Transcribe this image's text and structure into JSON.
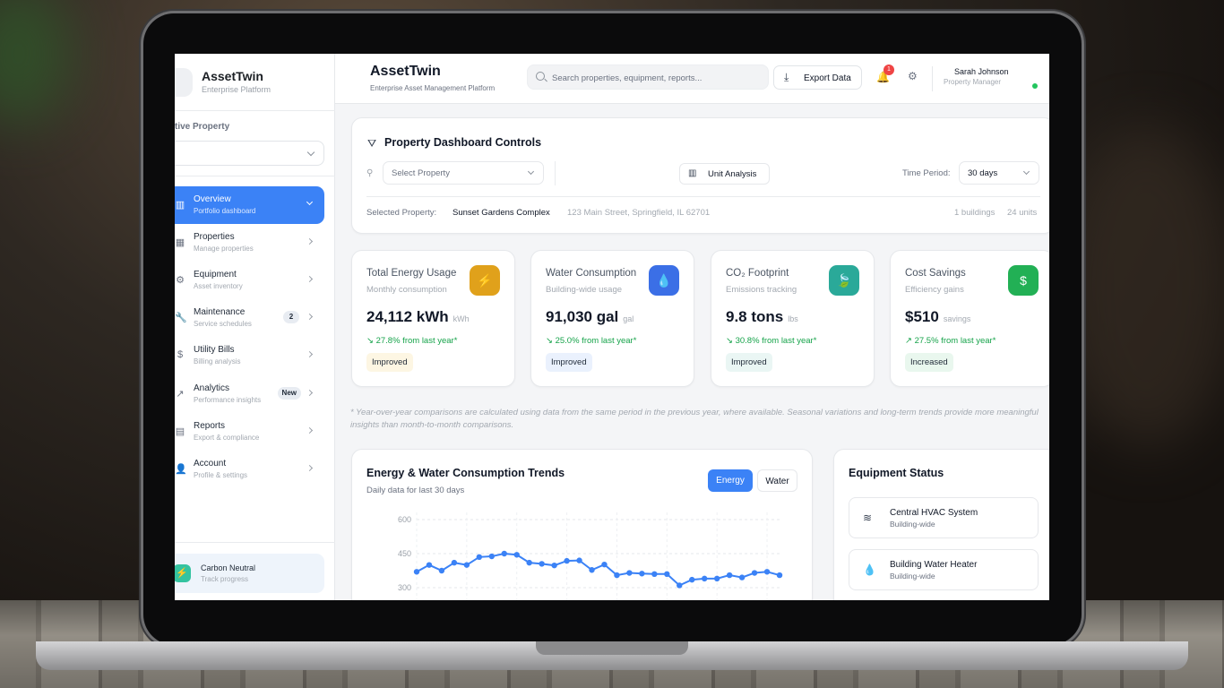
{
  "sidebar": {
    "brand": "AssetTwin",
    "brand_sub": "Enterprise Platform",
    "active_property_label": "tive Property",
    "items": [
      {
        "title": "Overview",
        "sub": "Portfolio dashboard",
        "icon": "bar-chart-icon"
      },
      {
        "title": "Properties",
        "sub": "Manage properties",
        "icon": "building-icon"
      },
      {
        "title": "Equipment",
        "sub": "Asset inventory",
        "icon": "gear-icon"
      },
      {
        "title": "Maintenance",
        "sub": "Service schedules",
        "icon": "wrench-icon",
        "badge": "2"
      },
      {
        "title": "Utility Bills",
        "sub": "Billing analysis",
        "icon": "dollar-icon"
      },
      {
        "title": "Analytics",
        "sub": "Performance insights",
        "icon": "trend-icon",
        "badge": "New"
      },
      {
        "title": "Reports",
        "sub": "Export & compliance",
        "icon": "document-icon"
      },
      {
        "title": "Account",
        "sub": "Profile & settings",
        "icon": "user-icon"
      }
    ],
    "carbon": {
      "title": "Carbon Neutral",
      "sub": "Track progress"
    }
  },
  "header": {
    "title": "AssetTwin",
    "subtitle": "Enterprise Asset Management Platform",
    "search_placeholder": "Search properties, equipment, reports...",
    "export_label": "Export Data",
    "notification_count": "1",
    "user_name": "Sarah Johnson",
    "user_role": "Property Manager"
  },
  "controls": {
    "title": "Property Dashboard Controls",
    "select_property": "Select Property",
    "unit_analysis": "Unit Analysis",
    "time_period_label": "Time Period:",
    "time_period_value": "30 days",
    "selected_label": "Selected Property:",
    "selected_name": "Sunset Gardens Complex",
    "selected_address": "123 Main Street, Springfield, IL 62701",
    "buildings": "1 buildings",
    "units": "24 units"
  },
  "metrics": [
    {
      "title": "Total Energy Usage",
      "sub": "Monthly consumption",
      "value": "24,112 kWh",
      "unit": "kWh",
      "trend": "↘ 27.8% from last year*",
      "pill": "Improved",
      "color": "#e0a11b",
      "pill_bg": "#fdf6e3"
    },
    {
      "title": "Water Consumption",
      "sub": "Building-wide usage",
      "value": "91,030 gal",
      "unit": "gal",
      "trend": "↘ 25.0% from last year*",
      "pill": "Improved",
      "color": "#3b6fe6",
      "pill_bg": "#eaf1fd"
    },
    {
      "title": "CO₂ Footprint",
      "sub": "Emissions tracking",
      "value": "9.8 tons",
      "unit": "lbs",
      "trend": "↘ 30.8% from last year*",
      "pill": "Improved",
      "color": "#2aa999",
      "pill_bg": "#eaf6f4"
    },
    {
      "title": "Cost Savings",
      "sub": "Efficiency gains",
      "value": "$510",
      "unit": "savings",
      "trend": "↗ 27.5% from last year*",
      "pill": "Increased",
      "color": "#22b055",
      "pill_bg": "#e9f7ee"
    }
  ],
  "footnote": "* Year-over-year comparisons are calculated using data from the same period in the previous year, where available. Seasonal variations and long-term trends provide more meaningful insights than month-to-month comparisons.",
  "trends": {
    "title": "Energy & Water Consumption Trends",
    "subtitle": "Daily data for last 30 days",
    "tab_energy": "Energy",
    "tab_water": "Water"
  },
  "chart_data": {
    "type": "line",
    "title": "Energy & Water Consumption Trends",
    "series": [
      {
        "values": [
          370,
          400,
          375,
          410,
          400,
          435,
          438,
          450,
          445,
          410,
          405,
          398,
          418,
          420,
          378,
          402,
          355,
          365,
          362,
          360,
          360,
          310,
          335,
          340,
          340,
          355,
          345,
          365,
          370,
          355
        ]
      }
    ],
    "yticks": [
      600,
      450,
      300
    ],
    "ylim": [
      250,
      650
    ],
    "grid": true
  },
  "equipment": {
    "title": "Equipment Status",
    "items": [
      {
        "name": "Central HVAC System",
        "location": "Building-wide"
      },
      {
        "name": "Building Water Heater",
        "location": "Building-wide"
      }
    ]
  }
}
